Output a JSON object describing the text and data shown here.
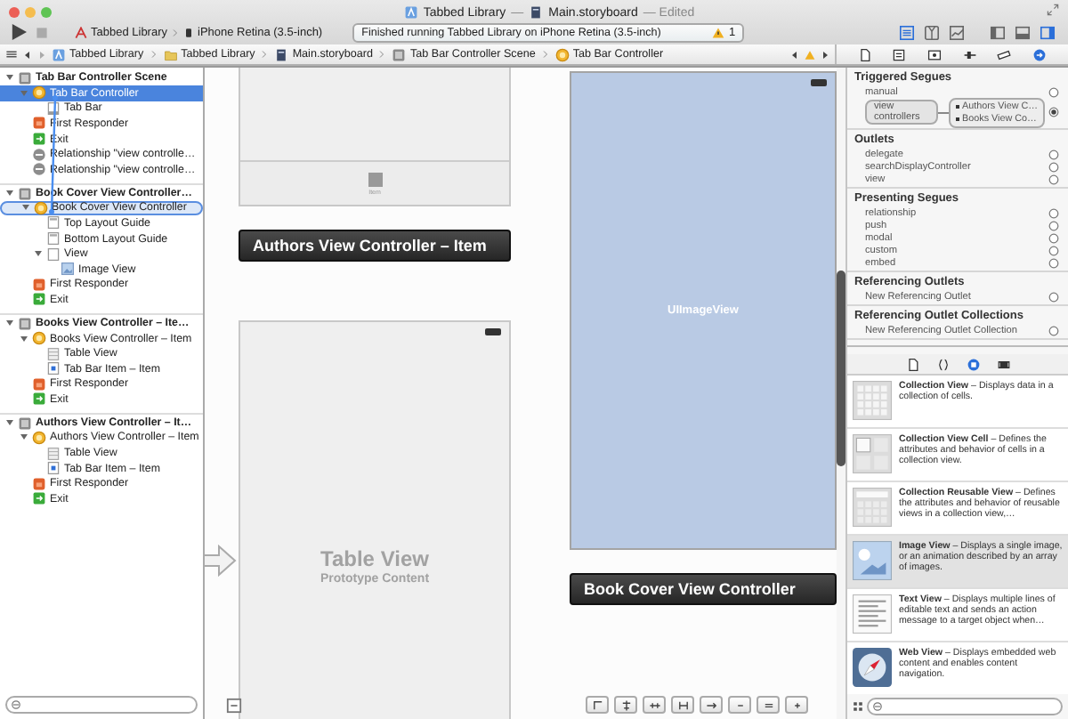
{
  "window": {
    "title": [
      {
        "kind": "project",
        "text": "Tabbed Library"
      },
      {
        "kind": "dim",
        "text": "—"
      },
      {
        "kind": "storyboard",
        "text": "Main.storyboard"
      },
      {
        "kind": "dim",
        "text": "— Edited"
      }
    ]
  },
  "toolbar": {
    "scheme": "Tabbed Library",
    "destination": "iPhone Retina (3.5-inch)",
    "activity": "Finished running Tabbed Library on iPhone Retina (3.5-inch)",
    "warning_count": "1",
    "editor_modes": [
      {
        "kind": "standard",
        "selected": true
      },
      {
        "kind": "assistant",
        "selected": false
      },
      {
        "kind": "version",
        "selected": false
      }
    ],
    "panels": [
      {
        "kind": "navigator",
        "on": false
      },
      {
        "kind": "debug",
        "on": false
      },
      {
        "kind": "utilities",
        "on": true
      }
    ]
  },
  "jump_bar": [
    {
      "kind": "project",
      "label": "Tabbed Library"
    },
    {
      "kind": "folder",
      "label": "Tabbed Library"
    },
    {
      "kind": "storyboard",
      "label": "Main.storyboard"
    },
    {
      "kind": "scene",
      "label": "Tab Bar Controller Scene"
    },
    {
      "kind": "controller",
      "label": "Tab Bar Controller"
    }
  ],
  "outline": [
    {
      "kind": "scene",
      "label": "Tab Bar Controller Scene",
      "selected": false,
      "drop_target": false,
      "expanded": true,
      "children": [
        {
          "kind": "controller",
          "label": "Tab Bar Controller",
          "selected": true,
          "drop_target": false,
          "expanded": true,
          "children": [
            {
              "kind": "tabbar",
              "label": "Tab Bar",
              "selected": false,
              "drop_target": false
            }
          ]
        },
        {
          "kind": "responder",
          "label": "First Responder",
          "selected": false,
          "drop_target": false
        },
        {
          "kind": "exit",
          "label": "Exit",
          "selected": false,
          "drop_target": false
        },
        {
          "kind": "relationship",
          "label": "Relationship \"view controlle…",
          "selected": false,
          "drop_target": false
        },
        {
          "kind": "relationship",
          "label": "Relationship \"view controlle…",
          "selected": false,
          "drop_target": false
        }
      ]
    },
    {
      "kind": "scene",
      "label": "Book Cover View Controller…",
      "selected": false,
      "drop_target": false,
      "expanded": true,
      "children": [
        {
          "kind": "controller",
          "label": "Book Cover View Controller",
          "selected": false,
          "drop_target": true,
          "expanded": true,
          "children": [
            {
              "kind": "guide",
              "label": "Top Layout Guide",
              "selected": false,
              "drop_target": false
            },
            {
              "kind": "guide",
              "label": "Bottom Layout Guide",
              "selected": false,
              "drop_target": false
            },
            {
              "kind": "view",
              "label": "View",
              "selected": false,
              "drop_target": false,
              "expanded": true,
              "children": [
                {
                  "kind": "image",
                  "label": "Image View",
                  "selected": false,
                  "drop_target": false
                }
              ]
            }
          ]
        },
        {
          "kind": "responder",
          "label": "First Responder",
          "selected": false,
          "drop_target": false
        },
        {
          "kind": "exit",
          "label": "Exit",
          "selected": false,
          "drop_target": false
        }
      ]
    },
    {
      "kind": "scene",
      "label": "Books View Controller – Ite…",
      "selected": false,
      "drop_target": false,
      "expanded": true,
      "children": [
        {
          "kind": "controller",
          "label": "Books View Controller – Item",
          "selected": false,
          "drop_target": false,
          "expanded": true,
          "children": [
            {
              "kind": "table",
              "label": "Table View",
              "selected": false,
              "drop_target": false
            },
            {
              "kind": "tabitem",
              "label": "Tab Bar Item – Item",
              "selected": false,
              "drop_target": false
            }
          ]
        },
        {
          "kind": "responder",
          "label": "First Responder",
          "selected": false,
          "drop_target": false
        },
        {
          "kind": "exit",
          "label": "Exit",
          "selected": false,
          "drop_target": false
        }
      ]
    },
    {
      "kind": "scene",
      "label": "Authors View Controller – It…",
      "selected": false,
      "drop_target": false,
      "expanded": true,
      "children": [
        {
          "kind": "controller",
          "label": "Authors View Controller – Item",
          "selected": false,
          "drop_target": false,
          "expanded": true,
          "children": [
            {
              "kind": "table",
              "label": "Table View",
              "selected": false,
              "drop_target": false
            },
            {
              "kind": "tabitem",
              "label": "Tab Bar Item – Item",
              "selected": false,
              "drop_target": false
            }
          ]
        },
        {
          "kind": "responder",
          "label": "First Responder",
          "selected": false,
          "drop_target": false
        },
        {
          "kind": "exit",
          "label": "Exit",
          "selected": false,
          "drop_target": false
        }
      ]
    }
  ],
  "canvas": {
    "scenes": [
      {
        "kind": "tab_view",
        "tab_label": "Item"
      },
      {
        "kind": "label",
        "text": "Authors View Controller – Item"
      },
      {
        "kind": "table_view",
        "title": "Table View",
        "subtitle": "Prototype Content"
      },
      {
        "kind": "image_view",
        "text": "UIImageView"
      },
      {
        "kind": "label",
        "text": "Book Cover View Controller"
      }
    ]
  },
  "inspector": {
    "tabs": [
      {
        "kind": "file",
        "selected": false
      },
      {
        "kind": "quick_help",
        "selected": false
      },
      {
        "kind": "identity",
        "selected": false
      },
      {
        "kind": "attributes",
        "selected": false
      },
      {
        "kind": "size",
        "selected": false
      },
      {
        "kind": "connections",
        "selected": true
      }
    ],
    "sections": [
      {
        "title": "Triggered Segues",
        "items": [
          {
            "label": "manual",
            "connected": false
          },
          {
            "label": "view controllers",
            "connected": true,
            "targets": [
              "Authors View C…",
              "Books View Co…"
            ]
          }
        ]
      },
      {
        "title": "Outlets",
        "items": [
          {
            "label": "delegate",
            "connected": false
          },
          {
            "label": "searchDisplayController",
            "connected": false
          },
          {
            "label": "view",
            "connected": false
          }
        ]
      },
      {
        "title": "Presenting Segues",
        "items": [
          {
            "label": "relationship",
            "connected": false
          },
          {
            "label": "push",
            "connected": false
          },
          {
            "label": "modal",
            "connected": false
          },
          {
            "label": "custom",
            "connected": false
          },
          {
            "label": "embed",
            "connected": false
          }
        ]
      },
      {
        "title": "Referencing Outlets",
        "items": [
          {
            "label": "New Referencing Outlet",
            "connected": false
          }
        ]
      },
      {
        "title": "Referencing Outlet Collections",
        "items": [
          {
            "label": "New Referencing Outlet Collection",
            "connected": false
          }
        ]
      }
    ]
  },
  "library": {
    "tabs": [
      {
        "kind": "file",
        "selected": false
      },
      {
        "kind": "code",
        "selected": false
      },
      {
        "kind": "object",
        "selected": true
      },
      {
        "kind": "media",
        "selected": false
      }
    ],
    "items": [
      {
        "kind": "collection",
        "text": "**Collection View** – Displays data in a collection of cells.",
        "selected": false
      },
      {
        "kind": "cell",
        "text": "**Collection View Cell** – Defines the attributes and behavior of cells in a collection view.",
        "selected": false
      },
      {
        "kind": "reusable",
        "text": "**Collection Reusable View** – Defines the attributes and behavior of reusable views in a collection view,…",
        "selected": false
      },
      {
        "kind": "image",
        "text": "**Image View** – Displays a single image, or an animation described by an array of images.",
        "selected": true
      },
      {
        "kind": "text",
        "text": "**Text View** – Displays multiple lines of editable text and sends an action message to a target object when…",
        "selected": false
      },
      {
        "kind": "web",
        "text": "**Web View** – Displays embedded web content and enables content navigation.",
        "selected": false
      }
    ]
  }
}
